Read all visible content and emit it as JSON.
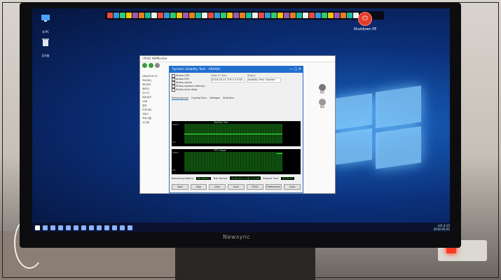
{
  "desktop": {
    "icons": [
      {
        "label": "내 PC",
        "icon": "computer-icon"
      },
      {
        "label": "휴지통",
        "icon": "recycle-bin-icon"
      }
    ],
    "shutdown_label": "Shutdown PE",
    "topbar_icons": [
      "app-icon",
      "app-icon",
      "app-icon",
      "app-icon",
      "app-icon",
      "app-icon",
      "app-icon",
      "app-icon",
      "app-icon",
      "app-icon",
      "app-icon",
      "app-icon",
      "app-icon",
      "app-icon",
      "app-icon",
      "app-icon",
      "app-icon",
      "app-icon",
      "app-icon",
      "app-icon",
      "app-icon",
      "app-icon",
      "app-icon",
      "app-icon",
      "app-icon",
      "app-icon",
      "app-icon",
      "app-icon",
      "app-icon",
      "app-icon",
      "app-icon",
      "app-icon",
      "app-icon",
      "app-icon",
      "app-icon",
      "app-icon",
      "app-icon",
      "app-icon",
      "app-icon",
      "app-icon"
    ]
  },
  "explorer": {
    "title": "CPUID HWMonitor",
    "tree": [
      "DESKTOP-01",
      "프로세서",
      "마더보드",
      "메모리",
      "디스크",
      "네트워크",
      "USB",
      "장치",
      "드라이버",
      "서비스",
      "프로그램",
      "시스템"
    ],
    "right_labels": [
      "옵션",
      "종료"
    ]
  },
  "stress_test": {
    "title": "System Stability Test - AIDA64",
    "checks": [
      "Stress CPU",
      "Stress FPU",
      "Stress cache",
      "Stress system memory",
      "Stress local disks"
    ],
    "col_date_header": "Date & Time",
    "col_date_value": "2016-05-01 오후 4:15:08",
    "col_status_header": "Status",
    "col_status_value": "Stability Test: Started",
    "tabs": [
      "Temperatures",
      "Cooling Fans",
      "Voltages",
      "Statistics"
    ],
    "graph1_label": "Stability Test",
    "graph1_y_top": "100°C",
    "graph1_y_bottom": "0°C",
    "graph2_label": "CPU Usage",
    "graph2_y_top": "100%",
    "graph2_y_bottom": "0%",
    "remaining_label": "Remaining Battery:",
    "remaining_value": "No battery",
    "test_started_label": "Test Started:",
    "test_started_value": "2016-05-01 오후 4:15:08",
    "elapsed_label": "Elapsed Time:",
    "elapsed_value": "00:00:37",
    "buttons": [
      "Start",
      "Stop",
      "Clear",
      "Save",
      "CPUID",
      "Preferences",
      "Close"
    ]
  },
  "taskbar": {
    "clock_time": "오후 4:15",
    "clock_date": "2016-05-01"
  },
  "monitor": {
    "brand": "Newsync"
  }
}
